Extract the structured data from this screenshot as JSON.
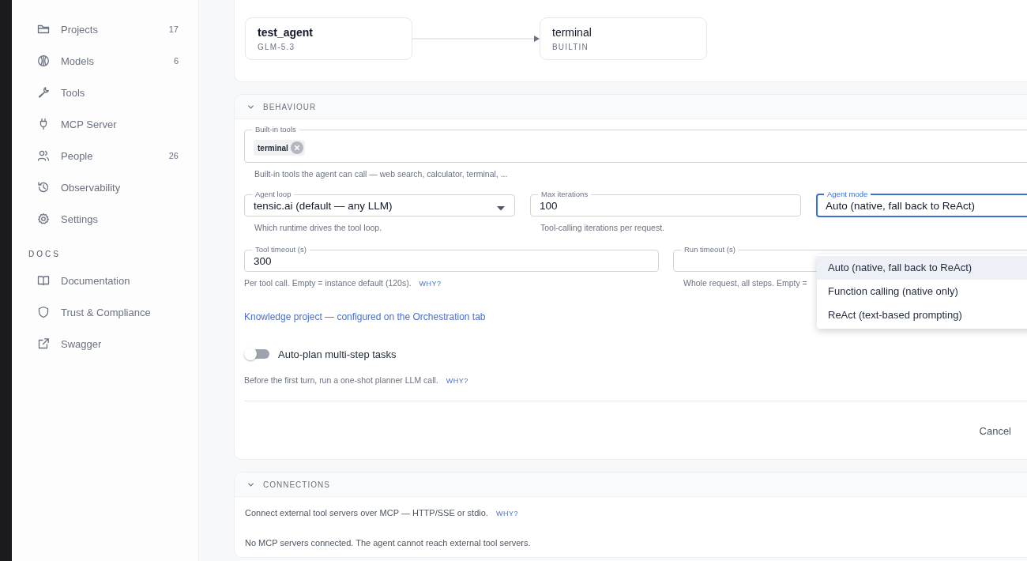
{
  "sidebar": {
    "nav_items": [
      {
        "label": "Projects",
        "count": "17"
      },
      {
        "label": "Models",
        "count": "6"
      },
      {
        "label": "Tools"
      },
      {
        "label": "MCP Server"
      },
      {
        "label": "People",
        "count": "26"
      },
      {
        "label": "Observability"
      },
      {
        "label": "Settings"
      }
    ],
    "docs_heading": "DOCS",
    "docs_items": [
      {
        "label": "Documentation"
      },
      {
        "label": "Trust & Compliance"
      },
      {
        "label": "Swagger"
      }
    ]
  },
  "graph": {
    "nodes": [
      {
        "name": "test_agent",
        "subtitle": "GLM-5.3"
      },
      {
        "name": "terminal",
        "subtitle": "BUILTIN"
      }
    ]
  },
  "behaviour": {
    "title": "BEHAVIOUR",
    "expanded": true,
    "builtin_tools": {
      "label": "Built-in tools",
      "chips": [
        "terminal"
      ],
      "help": "Built-in tools the agent can call — web search, calculator, terminal, ..."
    },
    "agent_loop": {
      "label": "Agent loop",
      "value": "tensic.ai (default — any LLM)",
      "help": "Which runtime drives the tool loop."
    },
    "max_iterations": {
      "label": "Max iterations",
      "value": "100",
      "help": "Tool-calling iterations per request."
    },
    "agent_mode": {
      "label": "Agent mode",
      "value": "Auto (native, fall back to ReAct)",
      "focused": true,
      "options": [
        {
          "label": "Auto (native, fall back to ReAct)",
          "selected": true
        },
        {
          "label": "Function calling (native only)",
          "selected": false
        },
        {
          "label": "ReAct (text-based prompting)",
          "selected": false
        }
      ]
    },
    "tool_timeout": {
      "label": "Tool timeout (s)",
      "value": "300",
      "help": "Per tool call. Empty = instance default (120s).",
      "why": "WHY?"
    },
    "run_timeout": {
      "label": "Run timeout (s)",
      "help": "Whole request, all steps. Empty ="
    },
    "knowledge_link": "Knowledge project — configured on the Orchestration tab",
    "auto_plan": {
      "label": "Auto-plan multi-step tasks",
      "on": false,
      "help": "Before the first turn, run a one-shot planner LLM call.",
      "why": "WHY?"
    },
    "cancel_button": "Cancel"
  },
  "connections": {
    "title": "CONNECTIONS",
    "expanded": true,
    "description": "Connect external tool servers over MCP — HTTP/SSE or stdio.",
    "why": "WHY?",
    "empty_message": "No MCP servers connected. The agent cannot reach external tool servers."
  }
}
